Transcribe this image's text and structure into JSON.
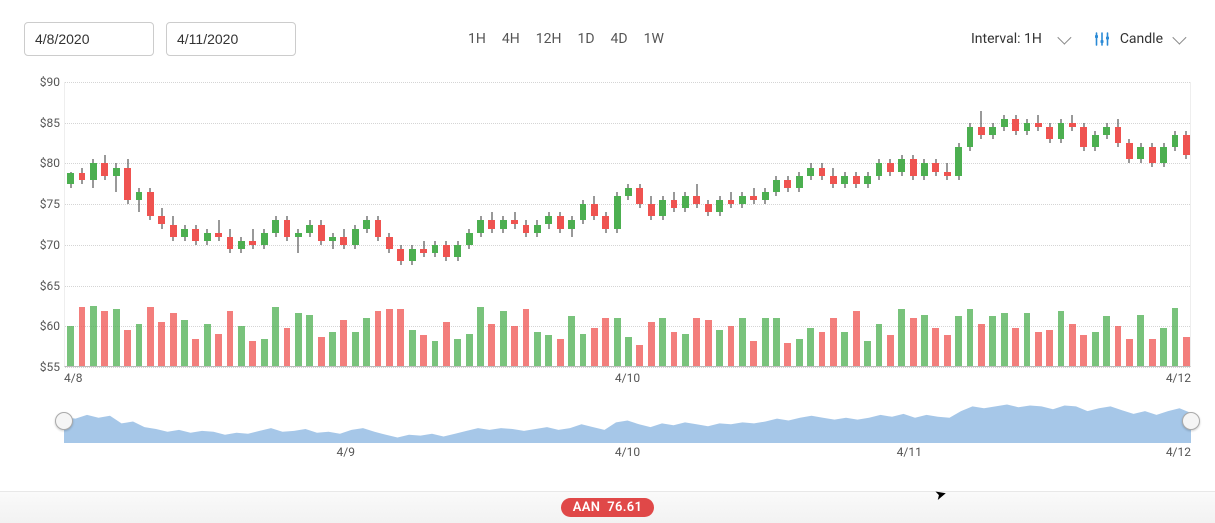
{
  "toolbar": {
    "date_from": "4/8/2020",
    "date_to": "4/11/2020",
    "ranges": [
      "1H",
      "4H",
      "12H",
      "1D",
      "4D",
      "1W"
    ],
    "interval_label": "Interval: 1H",
    "chart_type_label": "Candle"
  },
  "footer": {
    "ticker": "AAN",
    "price": "76.61"
  },
  "chart_data": {
    "type": "candlestick",
    "title": "",
    "xlabel": "",
    "ylabel": "",
    "ylim": [
      55,
      90
    ],
    "y_ticks": [
      55,
      60,
      65,
      70,
      75,
      80,
      85,
      90
    ],
    "y_tick_labels": [
      "$55",
      "$60",
      "$65",
      "$70",
      "$75",
      "$80",
      "$85",
      "$90"
    ],
    "x_ticks": [
      "4/8",
      "4/10",
      "4/12"
    ],
    "x_tick_pos": [
      0,
      0.5,
      1.0
    ],
    "vol_max": 65,
    "ohlcv": [
      {
        "o": 77.5,
        "h": 79.0,
        "l": 77.0,
        "c": 78.8,
        "v": 42,
        "dir": "up"
      },
      {
        "o": 78.8,
        "h": 79.5,
        "l": 77.5,
        "c": 78.0,
        "v": 62,
        "dir": "down"
      },
      {
        "o": 78.0,
        "h": 80.5,
        "l": 77.0,
        "c": 80.0,
        "v": 63,
        "dir": "up"
      },
      {
        "o": 80.0,
        "h": 81.0,
        "l": 78.0,
        "c": 78.5,
        "v": 58,
        "dir": "down"
      },
      {
        "o": 78.5,
        "h": 80.0,
        "l": 76.5,
        "c": 79.5,
        "v": 60,
        "dir": "up"
      },
      {
        "o": 79.5,
        "h": 80.5,
        "l": 75.0,
        "c": 75.5,
        "v": 38,
        "dir": "down"
      },
      {
        "o": 75.5,
        "h": 77.0,
        "l": 74.0,
        "c": 76.5,
        "v": 44,
        "dir": "up"
      },
      {
        "o": 76.5,
        "h": 77.0,
        "l": 73.0,
        "c": 73.5,
        "v": 62,
        "dir": "down"
      },
      {
        "o": 73.5,
        "h": 74.5,
        "l": 72.0,
        "c": 72.5,
        "v": 46,
        "dir": "down"
      },
      {
        "o": 72.5,
        "h": 73.5,
        "l": 70.5,
        "c": 71.0,
        "v": 56,
        "dir": "down"
      },
      {
        "o": 71.0,
        "h": 72.5,
        "l": 70.5,
        "c": 72.0,
        "v": 48,
        "dir": "up"
      },
      {
        "o": 72.0,
        "h": 72.5,
        "l": 70.0,
        "c": 70.5,
        "v": 28,
        "dir": "down"
      },
      {
        "o": 70.5,
        "h": 72.0,
        "l": 70.0,
        "c": 71.5,
        "v": 44,
        "dir": "up"
      },
      {
        "o": 71.5,
        "h": 73.0,
        "l": 70.5,
        "c": 71.0,
        "v": 34,
        "dir": "down"
      },
      {
        "o": 71.0,
        "h": 72.0,
        "l": 69.0,
        "c": 69.5,
        "v": 58,
        "dir": "down"
      },
      {
        "o": 69.5,
        "h": 71.0,
        "l": 69.0,
        "c": 70.5,
        "v": 42,
        "dir": "up"
      },
      {
        "o": 70.5,
        "h": 72.0,
        "l": 69.5,
        "c": 70.0,
        "v": 26,
        "dir": "down"
      },
      {
        "o": 70.0,
        "h": 72.0,
        "l": 69.5,
        "c": 71.5,
        "v": 28,
        "dir": "up"
      },
      {
        "o": 71.5,
        "h": 73.5,
        "l": 71.0,
        "c": 73.0,
        "v": 62,
        "dir": "up"
      },
      {
        "o": 73.0,
        "h": 73.5,
        "l": 70.5,
        "c": 71.0,
        "v": 40,
        "dir": "down"
      },
      {
        "o": 71.0,
        "h": 72.0,
        "l": 69.0,
        "c": 71.5,
        "v": 56,
        "dir": "up"
      },
      {
        "o": 71.5,
        "h": 73.0,
        "l": 71.0,
        "c": 72.5,
        "v": 54,
        "dir": "up"
      },
      {
        "o": 72.5,
        "h": 73.0,
        "l": 70.0,
        "c": 70.5,
        "v": 30,
        "dir": "down"
      },
      {
        "o": 70.5,
        "h": 71.5,
        "l": 69.5,
        "c": 71.0,
        "v": 36,
        "dir": "up"
      },
      {
        "o": 71.0,
        "h": 72.0,
        "l": 69.5,
        "c": 70.0,
        "v": 48,
        "dir": "down"
      },
      {
        "o": 70.0,
        "h": 72.5,
        "l": 69.5,
        "c": 72.0,
        "v": 36,
        "dir": "up"
      },
      {
        "o": 72.0,
        "h": 73.5,
        "l": 71.5,
        "c": 73.0,
        "v": 50,
        "dir": "up"
      },
      {
        "o": 73.0,
        "h": 73.5,
        "l": 70.5,
        "c": 71.0,
        "v": 58,
        "dir": "down"
      },
      {
        "o": 71.0,
        "h": 71.5,
        "l": 69.0,
        "c": 69.5,
        "v": 60,
        "dir": "down"
      },
      {
        "o": 69.5,
        "h": 70.0,
        "l": 67.5,
        "c": 68.0,
        "v": 60,
        "dir": "down"
      },
      {
        "o": 68.0,
        "h": 70.0,
        "l": 67.5,
        "c": 69.5,
        "v": 38,
        "dir": "up"
      },
      {
        "o": 69.5,
        "h": 70.5,
        "l": 68.5,
        "c": 69.0,
        "v": 32,
        "dir": "down"
      },
      {
        "o": 69.0,
        "h": 70.5,
        "l": 68.5,
        "c": 70.0,
        "v": 26,
        "dir": "up"
      },
      {
        "o": 70.0,
        "h": 70.5,
        "l": 68.0,
        "c": 68.5,
        "v": 46,
        "dir": "down"
      },
      {
        "o": 68.5,
        "h": 70.5,
        "l": 68.0,
        "c": 70.0,
        "v": 28,
        "dir": "up"
      },
      {
        "o": 70.0,
        "h": 72.0,
        "l": 69.5,
        "c": 71.5,
        "v": 34,
        "dir": "up"
      },
      {
        "o": 71.5,
        "h": 73.5,
        "l": 71.0,
        "c": 73.0,
        "v": 62,
        "dir": "up"
      },
      {
        "o": 73.0,
        "h": 74.0,
        "l": 71.5,
        "c": 72.0,
        "v": 44,
        "dir": "down"
      },
      {
        "o": 72.0,
        "h": 73.5,
        "l": 71.5,
        "c": 73.0,
        "v": 58,
        "dir": "up"
      },
      {
        "o": 73.0,
        "h": 74.0,
        "l": 72.0,
        "c": 72.5,
        "v": 42,
        "dir": "down"
      },
      {
        "o": 72.5,
        "h": 73.0,
        "l": 71.0,
        "c": 71.5,
        "v": 60,
        "dir": "down"
      },
      {
        "o": 71.5,
        "h": 73.0,
        "l": 71.0,
        "c": 72.5,
        "v": 36,
        "dir": "up"
      },
      {
        "o": 72.5,
        "h": 74.0,
        "l": 72.0,
        "c": 73.5,
        "v": 32,
        "dir": "up"
      },
      {
        "o": 73.5,
        "h": 74.0,
        "l": 71.5,
        "c": 72.0,
        "v": 28,
        "dir": "down"
      },
      {
        "o": 72.0,
        "h": 73.5,
        "l": 71.0,
        "c": 73.0,
        "v": 52,
        "dir": "up"
      },
      {
        "o": 73.0,
        "h": 75.5,
        "l": 72.5,
        "c": 75.0,
        "v": 34,
        "dir": "up"
      },
      {
        "o": 75.0,
        "h": 76.0,
        "l": 73.0,
        "c": 73.5,
        "v": 40,
        "dir": "down"
      },
      {
        "o": 73.5,
        "h": 74.0,
        "l": 71.5,
        "c": 72.0,
        "v": 50,
        "dir": "down"
      },
      {
        "o": 72.0,
        "h": 76.5,
        "l": 71.5,
        "c": 76.0,
        "v": 50,
        "dir": "up"
      },
      {
        "o": 76.0,
        "h": 77.5,
        "l": 75.5,
        "c": 77.0,
        "v": 30,
        "dir": "up"
      },
      {
        "o": 77.0,
        "h": 77.5,
        "l": 74.5,
        "c": 75.0,
        "v": 22,
        "dir": "down"
      },
      {
        "o": 75.0,
        "h": 76.0,
        "l": 73.0,
        "c": 73.5,
        "v": 46,
        "dir": "down"
      },
      {
        "o": 73.5,
        "h": 76.0,
        "l": 73.0,
        "c": 75.5,
        "v": 50,
        "dir": "up"
      },
      {
        "o": 75.5,
        "h": 76.5,
        "l": 74.0,
        "c": 74.5,
        "v": 36,
        "dir": "down"
      },
      {
        "o": 74.5,
        "h": 76.5,
        "l": 74.0,
        "c": 76.0,
        "v": 34,
        "dir": "up"
      },
      {
        "o": 76.0,
        "h": 77.5,
        "l": 74.5,
        "c": 75.0,
        "v": 50,
        "dir": "down"
      },
      {
        "o": 75.0,
        "h": 75.5,
        "l": 73.5,
        "c": 74.0,
        "v": 48,
        "dir": "down"
      },
      {
        "o": 74.0,
        "h": 76.0,
        "l": 73.5,
        "c": 75.5,
        "v": 38,
        "dir": "up"
      },
      {
        "o": 75.5,
        "h": 76.5,
        "l": 74.5,
        "c": 75.0,
        "v": 42,
        "dir": "down"
      },
      {
        "o": 75.0,
        "h": 76.5,
        "l": 74.5,
        "c": 76.0,
        "v": 50,
        "dir": "up"
      },
      {
        "o": 76.0,
        "h": 77.0,
        "l": 75.0,
        "c": 75.5,
        "v": 26,
        "dir": "down"
      },
      {
        "o": 75.5,
        "h": 77.0,
        "l": 75.0,
        "c": 76.5,
        "v": 50,
        "dir": "up"
      },
      {
        "o": 76.5,
        "h": 78.5,
        "l": 76.0,
        "c": 78.0,
        "v": 50,
        "dir": "up"
      },
      {
        "o": 78.0,
        "h": 78.5,
        "l": 76.5,
        "c": 77.0,
        "v": 24,
        "dir": "down"
      },
      {
        "o": 77.0,
        "h": 79.0,
        "l": 76.5,
        "c": 78.5,
        "v": 28,
        "dir": "up"
      },
      {
        "o": 78.5,
        "h": 80.0,
        "l": 78.0,
        "c": 79.5,
        "v": 40,
        "dir": "up"
      },
      {
        "o": 79.5,
        "h": 80.0,
        "l": 78.0,
        "c": 78.5,
        "v": 36,
        "dir": "down"
      },
      {
        "o": 78.5,
        "h": 79.5,
        "l": 77.0,
        "c": 77.5,
        "v": 50,
        "dir": "down"
      },
      {
        "o": 77.5,
        "h": 79.0,
        "l": 77.0,
        "c": 78.5,
        "v": 36,
        "dir": "up"
      },
      {
        "o": 78.5,
        "h": 79.0,
        "l": 77.0,
        "c": 77.5,
        "v": 58,
        "dir": "down"
      },
      {
        "o": 77.5,
        "h": 79.0,
        "l": 77.0,
        "c": 78.5,
        "v": 26,
        "dir": "up"
      },
      {
        "o": 78.5,
        "h": 80.5,
        "l": 78.0,
        "c": 80.0,
        "v": 44,
        "dir": "up"
      },
      {
        "o": 80.0,
        "h": 80.5,
        "l": 78.5,
        "c": 79.0,
        "v": 32,
        "dir": "down"
      },
      {
        "o": 79.0,
        "h": 81.0,
        "l": 78.5,
        "c": 80.5,
        "v": 60,
        "dir": "up"
      },
      {
        "o": 80.5,
        "h": 81.0,
        "l": 78.0,
        "c": 78.5,
        "v": 50,
        "dir": "down"
      },
      {
        "o": 78.5,
        "h": 80.5,
        "l": 78.0,
        "c": 80.0,
        "v": 54,
        "dir": "up"
      },
      {
        "o": 80.0,
        "h": 80.5,
        "l": 78.5,
        "c": 79.0,
        "v": 40,
        "dir": "down"
      },
      {
        "o": 79.0,
        "h": 80.0,
        "l": 78.0,
        "c": 78.5,
        "v": 32,
        "dir": "down"
      },
      {
        "o": 78.5,
        "h": 82.5,
        "l": 78.0,
        "c": 82.0,
        "v": 52,
        "dir": "up"
      },
      {
        "o": 82.0,
        "h": 85.0,
        "l": 81.5,
        "c": 84.5,
        "v": 60,
        "dir": "up"
      },
      {
        "o": 84.5,
        "h": 86.5,
        "l": 83.0,
        "c": 83.5,
        "v": 44,
        "dir": "down"
      },
      {
        "o": 83.5,
        "h": 85.0,
        "l": 83.0,
        "c": 84.5,
        "v": 52,
        "dir": "up"
      },
      {
        "o": 84.5,
        "h": 86.0,
        "l": 84.0,
        "c": 85.5,
        "v": 56,
        "dir": "up"
      },
      {
        "o": 85.5,
        "h": 86.0,
        "l": 83.5,
        "c": 84.0,
        "v": 40,
        "dir": "down"
      },
      {
        "o": 84.0,
        "h": 85.5,
        "l": 83.5,
        "c": 85.0,
        "v": 56,
        "dir": "up"
      },
      {
        "o": 85.0,
        "h": 86.0,
        "l": 84.0,
        "c": 84.5,
        "v": 36,
        "dir": "down"
      },
      {
        "o": 84.5,
        "h": 85.0,
        "l": 82.5,
        "c": 83.0,
        "v": 38,
        "dir": "down"
      },
      {
        "o": 83.0,
        "h": 85.5,
        "l": 82.5,
        "c": 85.0,
        "v": 58,
        "dir": "up"
      },
      {
        "o": 85.0,
        "h": 86.0,
        "l": 84.0,
        "c": 84.5,
        "v": 44,
        "dir": "down"
      },
      {
        "o": 84.5,
        "h": 85.0,
        "l": 81.5,
        "c": 82.0,
        "v": 32,
        "dir": "down"
      },
      {
        "o": 82.0,
        "h": 84.0,
        "l": 81.5,
        "c": 83.5,
        "v": 36,
        "dir": "up"
      },
      {
        "o": 83.5,
        "h": 85.0,
        "l": 83.0,
        "c": 84.5,
        "v": 52,
        "dir": "up"
      },
      {
        "o": 84.5,
        "h": 85.5,
        "l": 82.0,
        "c": 82.5,
        "v": 42,
        "dir": "down"
      },
      {
        "o": 82.5,
        "h": 83.0,
        "l": 80.0,
        "c": 80.5,
        "v": 28,
        "dir": "down"
      },
      {
        "o": 80.5,
        "h": 82.5,
        "l": 80.0,
        "c": 82.0,
        "v": 54,
        "dir": "up"
      },
      {
        "o": 82.0,
        "h": 82.5,
        "l": 79.5,
        "c": 80.0,
        "v": 28,
        "dir": "down"
      },
      {
        "o": 80.0,
        "h": 82.5,
        "l": 79.5,
        "c": 82.0,
        "v": 40,
        "dir": "up"
      },
      {
        "o": 82.0,
        "h": 84.0,
        "l": 81.5,
        "c": 83.5,
        "v": 61,
        "dir": "up"
      },
      {
        "o": 83.5,
        "h": 84.0,
        "l": 80.5,
        "c": 81.0,
        "v": 30,
        "dir": "down"
      }
    ],
    "navigator": {
      "x_ticks": [
        "4/9",
        "4/10",
        "4/11",
        "4/12"
      ],
      "x_tick_pos": [
        0.25,
        0.5,
        0.75,
        1.0
      ]
    }
  }
}
